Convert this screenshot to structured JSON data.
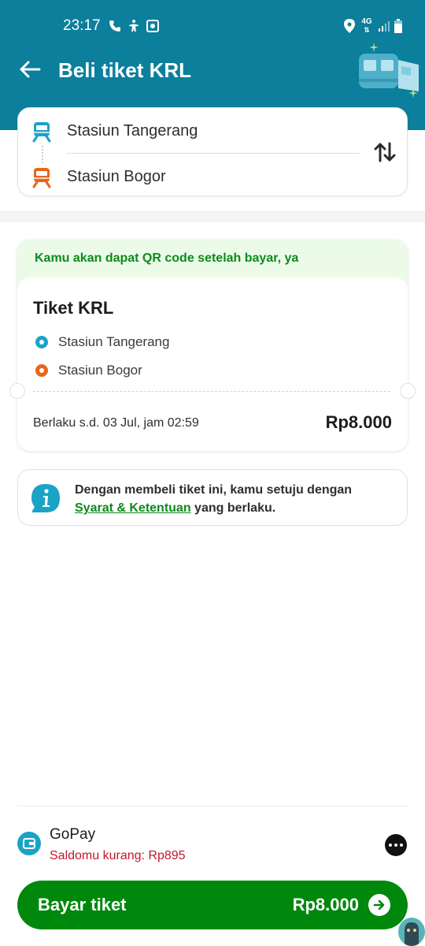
{
  "status_bar": {
    "time": "23:17",
    "network": "4G"
  },
  "header": {
    "title": "Beli tiket KRL"
  },
  "stations": {
    "origin": "Stasiun Tangerang",
    "destination": "Stasiun Bogor"
  },
  "ticket": {
    "note": "Kamu akan dapat QR code setelah bayar, ya",
    "title": "Tiket KRL",
    "from": "Stasiun Tangerang",
    "to": "Stasiun Bogor",
    "validity": "Berlaku s.d. 03 Jul, jam 02:59",
    "price": "Rp8.000"
  },
  "info": {
    "text_before": "Dengan membeli tiket ini, kamu setuju dengan",
    "link": "Syarat & Ketentuan",
    "text_after": "yang berlaku."
  },
  "payment": {
    "method": "GoPay",
    "warning": "Saldomu kurang: Rp895"
  },
  "pay_button": {
    "label": "Bayar tiket",
    "amount": "Rp8.000"
  },
  "colors": {
    "header": "#0b7f9c",
    "accent_green": "#00880d",
    "origin_blue": "#1aa3c6",
    "destination_orange": "#e8661b",
    "warning_red": "#c4162a"
  }
}
